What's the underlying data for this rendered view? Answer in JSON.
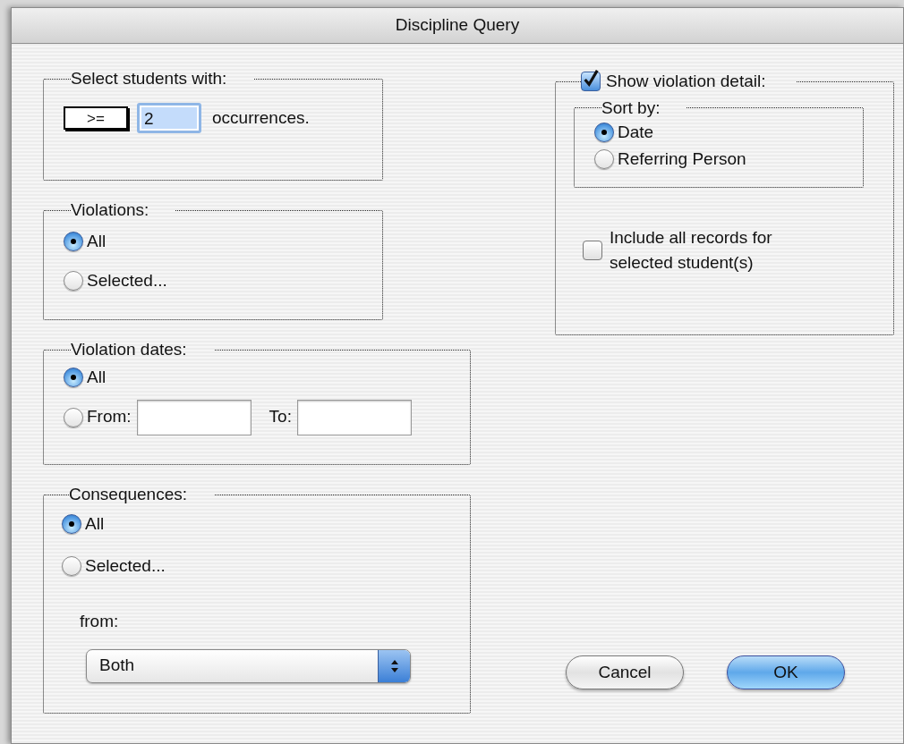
{
  "window": {
    "title": "Discipline Query"
  },
  "select_students": {
    "legend": "Select students with:",
    "operator": ">=",
    "count": "2",
    "suffix": "occurrences."
  },
  "violations": {
    "legend": "Violations:",
    "options": [
      {
        "label": "All",
        "selected": true
      },
      {
        "label": "Selected...",
        "selected": false
      }
    ]
  },
  "violation_dates": {
    "legend": "Violation dates:",
    "options": [
      {
        "label": "All",
        "selected": true
      },
      {
        "label": "From:",
        "selected": false
      }
    ],
    "to_label": "To:"
  },
  "consequences": {
    "legend": "Consequences:",
    "options": [
      {
        "label": "All",
        "selected": true
      },
      {
        "label": "Selected...",
        "selected": false
      }
    ],
    "from_label": "from:",
    "source": "Both"
  },
  "violation_detail": {
    "label": "Show violation detail:",
    "checked": true,
    "sort_by": {
      "legend": "Sort by:",
      "options": [
        {
          "label": "Date",
          "selected": true
        },
        {
          "label": "Referring Person",
          "selected": false
        }
      ]
    },
    "include_all": {
      "label": "Include all records for selected student(s)",
      "checked": false
    }
  },
  "buttons": [
    {
      "label": "Cancel",
      "default": false
    },
    {
      "label": "OK",
      "default": true
    }
  ]
}
